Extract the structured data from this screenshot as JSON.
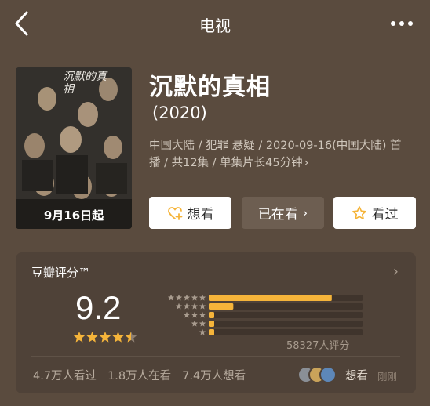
{
  "header": {
    "title": "电视",
    "back_icon": "chevron-left-icon",
    "more_icon": "more-dots-icon"
  },
  "show": {
    "title": "沉默的真相",
    "year": "(2020)",
    "meta": "中国大陆 / 犯罪 悬疑 / 2020-09-16(中国大陆) 首播 / 共12集 / 单集片长45分钟",
    "poster": {
      "date_text": "9月16日起",
      "title_art": "沉默的真相"
    }
  },
  "actions": {
    "want_label": "想看",
    "watching_label": "已在看",
    "watched_label": "看过"
  },
  "rating": {
    "header": "豆瓣评分™",
    "score": "9.2",
    "stars": 4.5,
    "distribution": [
      0.8,
      0.16,
      0.03,
      0.01,
      0.01
    ],
    "count_label": "58327人评分",
    "stats": {
      "watched": "4.7万人看过",
      "watching": "1.8万人在看",
      "want": "7.4万人想看"
    },
    "friends_label": "想看",
    "friends_time": "刚刚"
  },
  "colors": {
    "background": "#5a4b3e",
    "card": "#4f4238",
    "accent": "#f5b43a",
    "muted": "#a89b8e"
  }
}
